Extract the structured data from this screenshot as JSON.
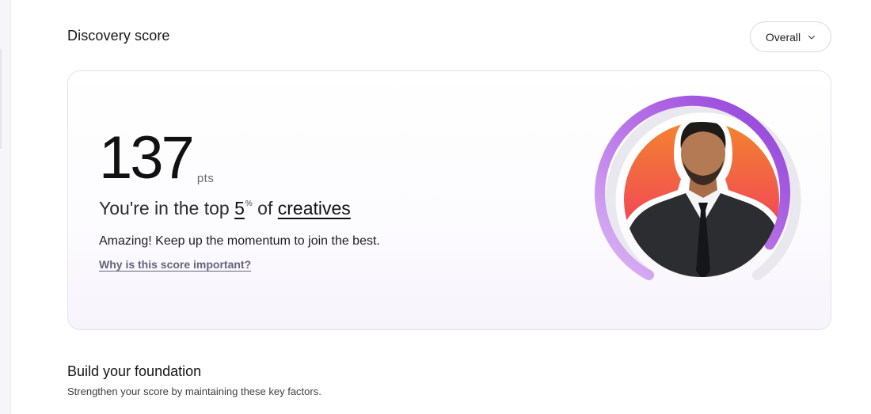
{
  "header": {
    "title": "Discovery score",
    "filter": {
      "selected": "Overall",
      "icon": "chevron-down-icon"
    }
  },
  "score_card": {
    "score": "137",
    "unit": "pts",
    "rank_prefix": "You're in the top",
    "rank_value": "5",
    "rank_superscript": "%",
    "rank_middle": "of",
    "rank_group": "creatives",
    "message": "Amazing! Keep up the momentum to join the best.",
    "link": "Why is this score important?",
    "gauge": {
      "progress": 0.95,
      "colors": {
        "start": "#dcb8f5",
        "mid": "#b56ee6",
        "end": "#8e3fd8",
        "track": "#e8e8ee"
      },
      "avatar_background": {
        "top": "#f3842f",
        "bottom": "#f0286a"
      }
    }
  },
  "foundation": {
    "title": "Build your foundation",
    "subtitle": "Strengthen your score by maintaining these key factors."
  }
}
